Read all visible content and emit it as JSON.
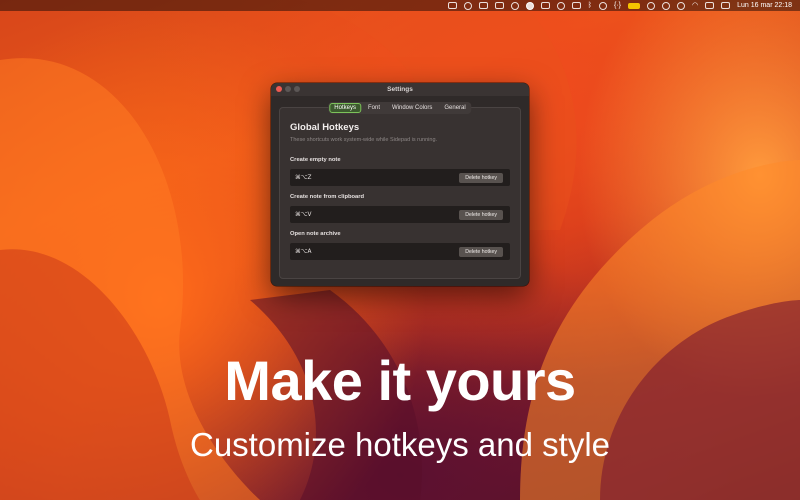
{
  "menubar": {
    "datetime": "Lun 16 mar  22:18",
    "icons": [
      "document-icon",
      "share-icon",
      "image-icon",
      "coffee-icon",
      "feather-icon",
      "record-icon",
      "mail-icon",
      "headphones-icon",
      "display-icon",
      "bluetooth-icon",
      "play-icon",
      "brackets-icon",
      "battery-icon",
      "audio-icon",
      "airplay-icon",
      "clock-icon",
      "wifi-icon",
      "list-icon",
      "control-center-icon"
    ]
  },
  "window": {
    "title": "Settings",
    "tabs": [
      {
        "label": "Hotkeys",
        "active": true
      },
      {
        "label": "Font",
        "active": false
      },
      {
        "label": "Window Colors",
        "active": false
      },
      {
        "label": "General",
        "active": false
      }
    ],
    "section_title": "Global Hotkeys",
    "section_subtitle": "These shortcuts work system-wide while Sidepad is running.",
    "hotkeys": [
      {
        "label": "Create empty note",
        "key": "⌘⌥Z",
        "button": "Delete hotkey"
      },
      {
        "label": "Create note from clipboard",
        "key": "⌘⌥V",
        "button": "Delete hotkey"
      },
      {
        "label": "Open note archive",
        "key": "⌘⌥A",
        "button": "Delete hotkey"
      }
    ]
  },
  "marketing": {
    "headline": "Make it yours",
    "subline": "Customize hotkeys and style"
  },
  "colors": {
    "accent_green": "#7cc35a",
    "battery_yellow": "#f5c400",
    "close_red": "#ee5a52"
  }
}
